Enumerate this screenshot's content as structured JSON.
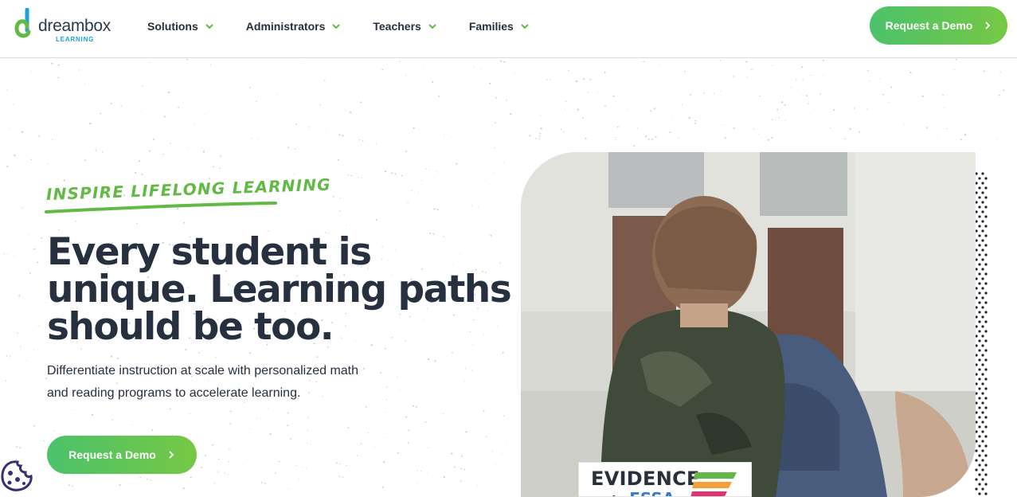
{
  "brand": {
    "name": "dreambox",
    "sub": "LEARNING",
    "colors": {
      "green": "#63b945",
      "blue": "#1ea2d6",
      "navy": "#26303f"
    }
  },
  "nav": {
    "items": [
      {
        "label": "Solutions"
      },
      {
        "label": "Administrators"
      },
      {
        "label": "Teachers"
      },
      {
        "label": "Families"
      }
    ],
    "cta_label": "Request a Demo"
  },
  "hero": {
    "eyebrow": "INSPIRE LIFELONG LEARNING",
    "headline_lines": [
      "Every student is",
      "unique. Learning paths",
      "should be too."
    ],
    "subtext_lines": [
      "Differentiate instruction at scale with personalized math",
      "and reading programs to accelerate learning."
    ],
    "cta_label": "Request a Demo"
  },
  "badge": {
    "title": "EVIDENCE",
    "sub_prefix": "for",
    "sub_main": "ESSA"
  },
  "icons": {
    "nav_chevron": "chevron-down-icon",
    "cta_arrow": "chevron-right-icon",
    "cookie": "cookie-icon"
  }
}
